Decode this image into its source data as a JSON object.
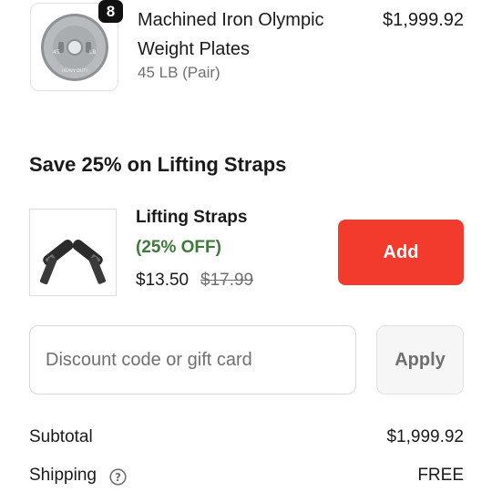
{
  "line_item": {
    "quantity": "8",
    "title": "Machined Iron Olympic Weight Plates",
    "variant": "45 LB (Pair)",
    "price": "$1,999.92",
    "thumbnail_text": {
      "left": "45",
      "right": "LB",
      "bottom": "HEAVY DUTY"
    }
  },
  "upsell": {
    "heading": "Save 25% on Lifting Straps",
    "name": "Lifting Straps",
    "discount": "(25% OFF)",
    "price": "$13.50",
    "compare_price": "$17.99",
    "add_label": "Add"
  },
  "discount": {
    "placeholder": "Discount code or gift card",
    "apply_label": "Apply"
  },
  "summary": {
    "subtotal_label": "Subtotal",
    "subtotal_value": "$1,999.92",
    "shipping_label": "Shipping",
    "shipping_value": "FREE"
  },
  "colors": {
    "accent_red": "#f23b2d",
    "discount_green": "#3f7a3a"
  }
}
